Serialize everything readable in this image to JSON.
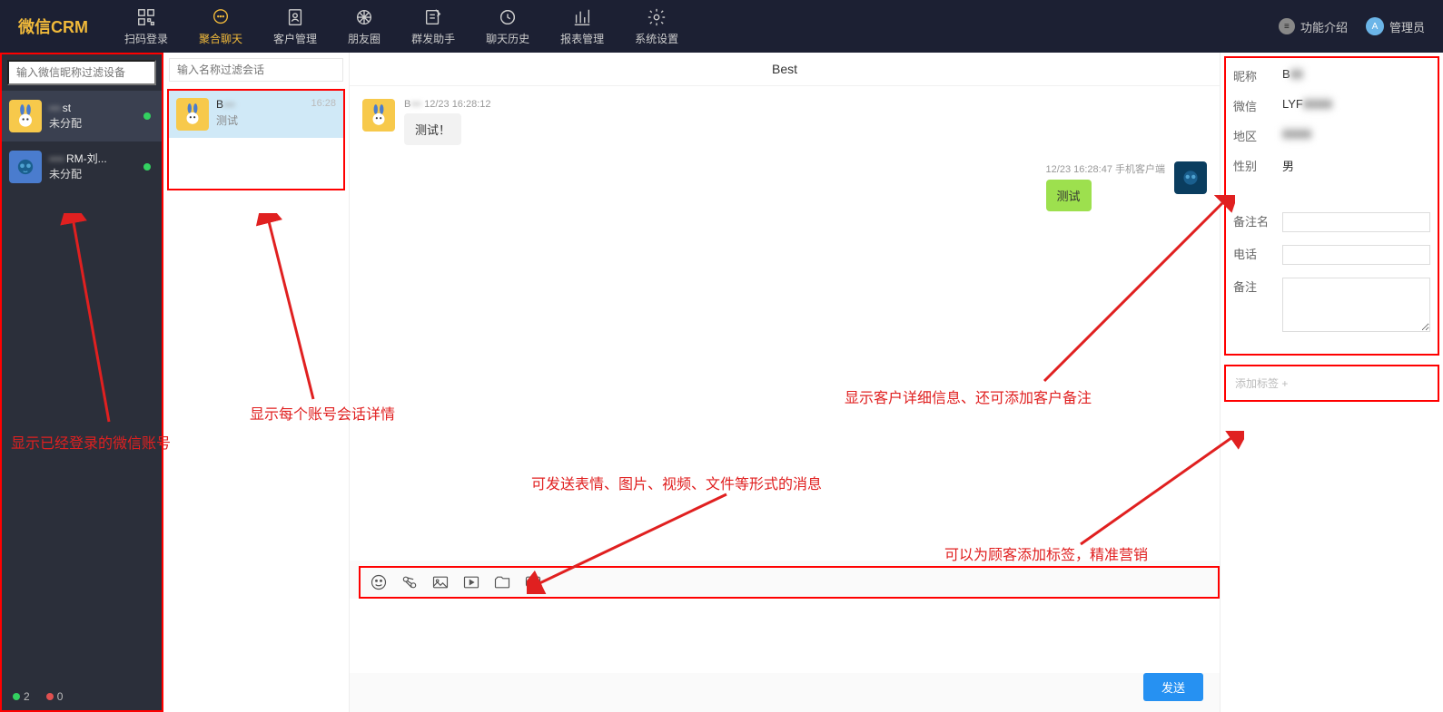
{
  "brand": "微信CRM",
  "nav": [
    {
      "label": "扫码登录",
      "icon": "qr"
    },
    {
      "label": "聚合聊天",
      "icon": "chat",
      "active": true
    },
    {
      "label": "客户管理",
      "icon": "contacts"
    },
    {
      "label": "朋友圈",
      "icon": "moments"
    },
    {
      "label": "群发助手",
      "icon": "broadcast"
    },
    {
      "label": "聊天历史",
      "icon": "history"
    },
    {
      "label": "报表管理",
      "icon": "report"
    },
    {
      "label": "系统设置",
      "icon": "settings"
    }
  ],
  "top_right": {
    "features": "功能介绍",
    "admin": "管理员"
  },
  "left": {
    "search_placeholder": "输入微信昵称过滤设备",
    "accounts": [
      {
        "name_prefix": "",
        "name_suffix": "st",
        "status": "未分配",
        "avatar": "bunny"
      },
      {
        "name_prefix": "",
        "name_suffix": "RM-刘...",
        "status": "未分配",
        "avatar": "elephant"
      }
    ],
    "online_count": "2",
    "offline_count": "0"
  },
  "conv": {
    "search_placeholder": "输入名称过滤会话",
    "items": [
      {
        "name_prefix": "B",
        "time": "16:28",
        "preview": "测试"
      }
    ]
  },
  "chat": {
    "title": "Best",
    "messages": [
      {
        "side": "left",
        "meta_prefix": "B",
        "meta_time": "12/23 16:28:12",
        "text": "测试！",
        "avatar": "bunny"
      },
      {
        "side": "right",
        "meta_time": "12/23 16:28:47 手机客户端",
        "text": "测试",
        "avatar": "elephant"
      }
    ],
    "send_label": "发送"
  },
  "detail": {
    "fields": {
      "nick_label": "昵称",
      "nick_value": "B",
      "wx_label": "微信",
      "wx_value": "LYF",
      "region_label": "地区",
      "region_value": "",
      "gender_label": "性别",
      "gender_value": "男",
      "remark_name_label": "备注名",
      "phone_label": "电话",
      "remark_label": "备注"
    },
    "tag_placeholder": "添加标签 +"
  },
  "annotations": {
    "a1": "显示已经登录的微信账号",
    "a2": "显示每个账号会话详情",
    "a3": "可发送表情、图片、视频、文件等形式的消息",
    "a4": "显示客户详细信息、还可添加客户备注",
    "a5": "可以为顾客添加标签，精准营销"
  }
}
